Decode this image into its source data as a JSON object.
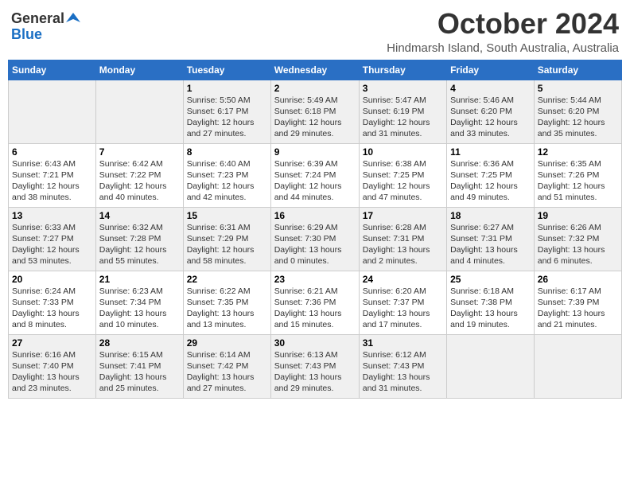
{
  "logo": {
    "general": "General",
    "blue": "Blue"
  },
  "title": {
    "month": "October 2024",
    "location": "Hindmarsh Island, South Australia, Australia"
  },
  "days_of_week": [
    "Sunday",
    "Monday",
    "Tuesday",
    "Wednesday",
    "Thursday",
    "Friday",
    "Saturday"
  ],
  "weeks": [
    [
      {
        "day": "",
        "info": ""
      },
      {
        "day": "",
        "info": ""
      },
      {
        "day": "1",
        "info": "Sunrise: 5:50 AM\nSunset: 6:17 PM\nDaylight: 12 hours\nand 27 minutes."
      },
      {
        "day": "2",
        "info": "Sunrise: 5:49 AM\nSunset: 6:18 PM\nDaylight: 12 hours\nand 29 minutes."
      },
      {
        "day": "3",
        "info": "Sunrise: 5:47 AM\nSunset: 6:19 PM\nDaylight: 12 hours\nand 31 minutes."
      },
      {
        "day": "4",
        "info": "Sunrise: 5:46 AM\nSunset: 6:20 PM\nDaylight: 12 hours\nand 33 minutes."
      },
      {
        "day": "5",
        "info": "Sunrise: 5:44 AM\nSunset: 6:20 PM\nDaylight: 12 hours\nand 35 minutes."
      }
    ],
    [
      {
        "day": "6",
        "info": "Sunrise: 6:43 AM\nSunset: 7:21 PM\nDaylight: 12 hours\nand 38 minutes."
      },
      {
        "day": "7",
        "info": "Sunrise: 6:42 AM\nSunset: 7:22 PM\nDaylight: 12 hours\nand 40 minutes."
      },
      {
        "day": "8",
        "info": "Sunrise: 6:40 AM\nSunset: 7:23 PM\nDaylight: 12 hours\nand 42 minutes."
      },
      {
        "day": "9",
        "info": "Sunrise: 6:39 AM\nSunset: 7:24 PM\nDaylight: 12 hours\nand 44 minutes."
      },
      {
        "day": "10",
        "info": "Sunrise: 6:38 AM\nSunset: 7:25 PM\nDaylight: 12 hours\nand 47 minutes."
      },
      {
        "day": "11",
        "info": "Sunrise: 6:36 AM\nSunset: 7:25 PM\nDaylight: 12 hours\nand 49 minutes."
      },
      {
        "day": "12",
        "info": "Sunrise: 6:35 AM\nSunset: 7:26 PM\nDaylight: 12 hours\nand 51 minutes."
      }
    ],
    [
      {
        "day": "13",
        "info": "Sunrise: 6:33 AM\nSunset: 7:27 PM\nDaylight: 12 hours\nand 53 minutes."
      },
      {
        "day": "14",
        "info": "Sunrise: 6:32 AM\nSunset: 7:28 PM\nDaylight: 12 hours\nand 55 minutes."
      },
      {
        "day": "15",
        "info": "Sunrise: 6:31 AM\nSunset: 7:29 PM\nDaylight: 12 hours\nand 58 minutes."
      },
      {
        "day": "16",
        "info": "Sunrise: 6:29 AM\nSunset: 7:30 PM\nDaylight: 13 hours\nand 0 minutes."
      },
      {
        "day": "17",
        "info": "Sunrise: 6:28 AM\nSunset: 7:31 PM\nDaylight: 13 hours\nand 2 minutes."
      },
      {
        "day": "18",
        "info": "Sunrise: 6:27 AM\nSunset: 7:31 PM\nDaylight: 13 hours\nand 4 minutes."
      },
      {
        "day": "19",
        "info": "Sunrise: 6:26 AM\nSunset: 7:32 PM\nDaylight: 13 hours\nand 6 minutes."
      }
    ],
    [
      {
        "day": "20",
        "info": "Sunrise: 6:24 AM\nSunset: 7:33 PM\nDaylight: 13 hours\nand 8 minutes."
      },
      {
        "day": "21",
        "info": "Sunrise: 6:23 AM\nSunset: 7:34 PM\nDaylight: 13 hours\nand 10 minutes."
      },
      {
        "day": "22",
        "info": "Sunrise: 6:22 AM\nSunset: 7:35 PM\nDaylight: 13 hours\nand 13 minutes."
      },
      {
        "day": "23",
        "info": "Sunrise: 6:21 AM\nSunset: 7:36 PM\nDaylight: 13 hours\nand 15 minutes."
      },
      {
        "day": "24",
        "info": "Sunrise: 6:20 AM\nSunset: 7:37 PM\nDaylight: 13 hours\nand 17 minutes."
      },
      {
        "day": "25",
        "info": "Sunrise: 6:18 AM\nSunset: 7:38 PM\nDaylight: 13 hours\nand 19 minutes."
      },
      {
        "day": "26",
        "info": "Sunrise: 6:17 AM\nSunset: 7:39 PM\nDaylight: 13 hours\nand 21 minutes."
      }
    ],
    [
      {
        "day": "27",
        "info": "Sunrise: 6:16 AM\nSunset: 7:40 PM\nDaylight: 13 hours\nand 23 minutes."
      },
      {
        "day": "28",
        "info": "Sunrise: 6:15 AM\nSunset: 7:41 PM\nDaylight: 13 hours\nand 25 minutes."
      },
      {
        "day": "29",
        "info": "Sunrise: 6:14 AM\nSunset: 7:42 PM\nDaylight: 13 hours\nand 27 minutes."
      },
      {
        "day": "30",
        "info": "Sunrise: 6:13 AM\nSunset: 7:43 PM\nDaylight: 13 hours\nand 29 minutes."
      },
      {
        "day": "31",
        "info": "Sunrise: 6:12 AM\nSunset: 7:43 PM\nDaylight: 13 hours\nand 31 minutes."
      },
      {
        "day": "",
        "info": ""
      },
      {
        "day": "",
        "info": ""
      }
    ]
  ]
}
